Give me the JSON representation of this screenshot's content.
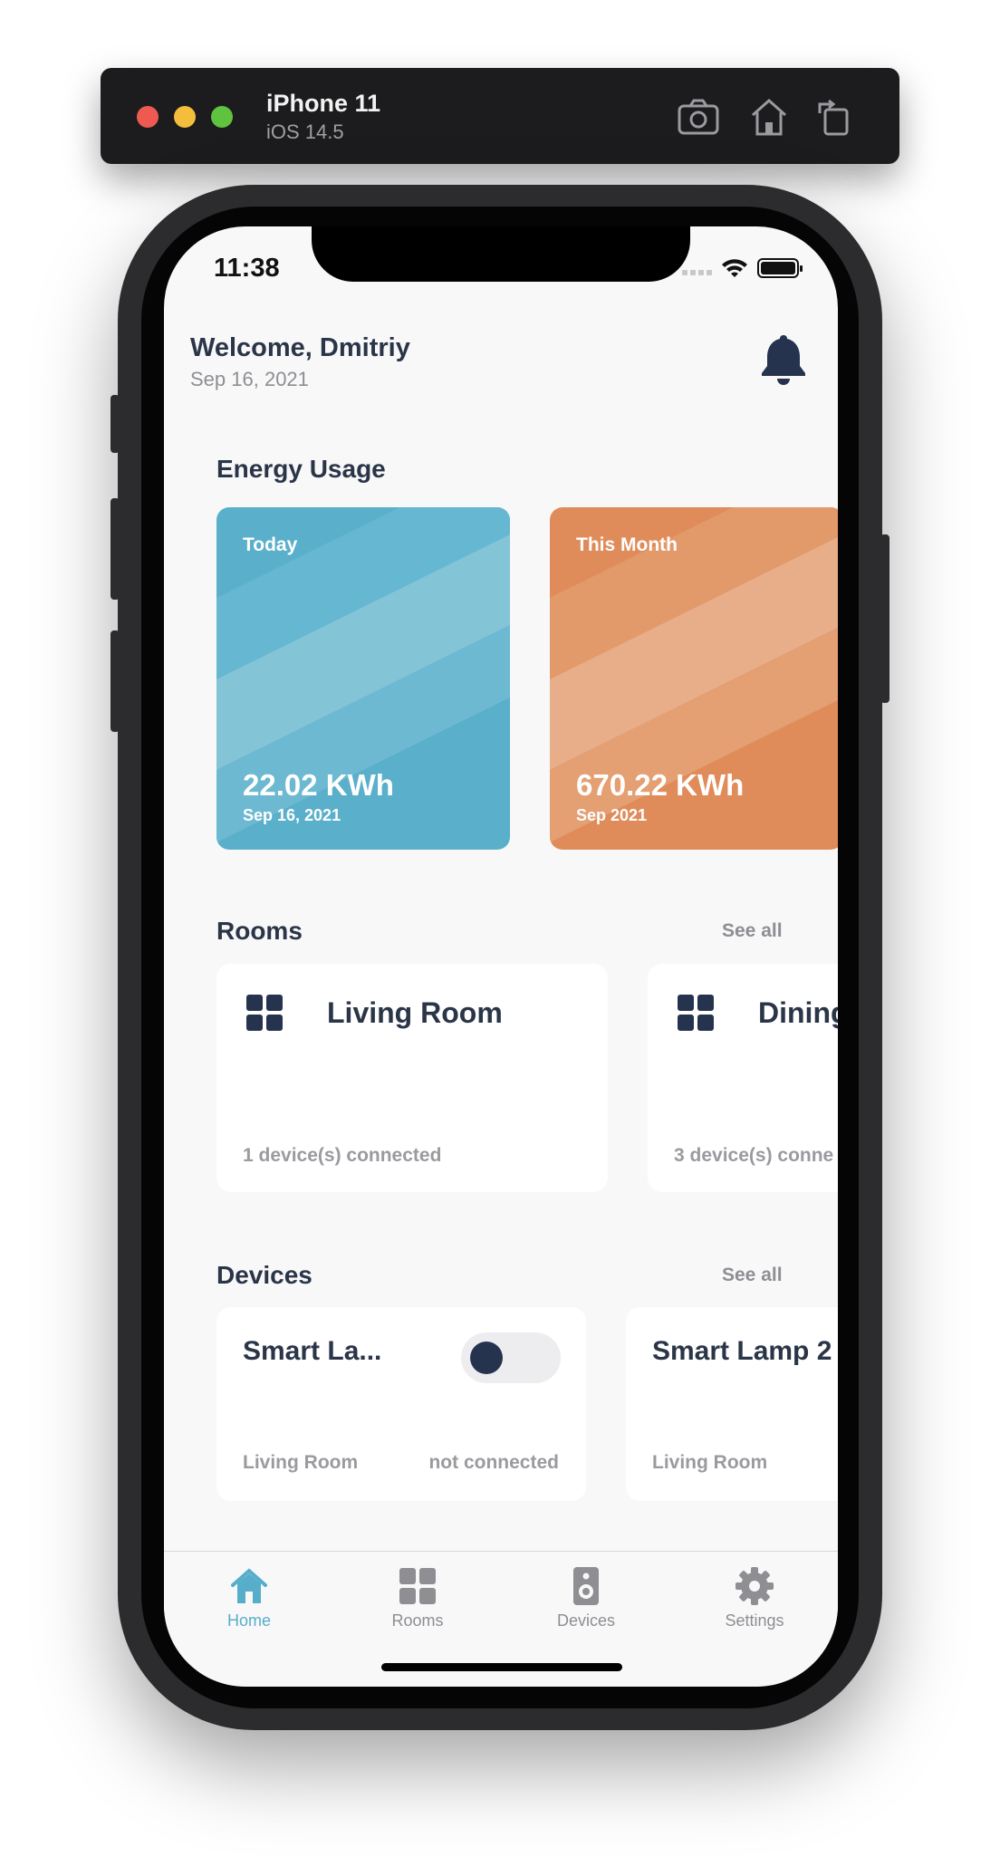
{
  "simulator": {
    "device_name": "iPhone 11",
    "os_version": "iOS 14.5",
    "toolbar_icons": [
      "screenshot-icon",
      "home-icon",
      "rotate-icon"
    ]
  },
  "status_bar": {
    "time": "11:38",
    "icons": [
      "signal-icon",
      "wifi-icon",
      "battery-icon"
    ]
  },
  "header": {
    "welcome": "Welcome, Dmitriy",
    "date": "Sep 16, 2021",
    "notification_icon": "bell-icon"
  },
  "energy": {
    "title": "Energy Usage",
    "cards": [
      {
        "label": "Today",
        "value": "22.02 KWh",
        "date": "Sep 16, 2021",
        "color": "#5aafcb"
      },
      {
        "label": "This Month",
        "value": "670.22 KWh",
        "date": "Sep 2021",
        "color": "#e08c5a"
      }
    ]
  },
  "rooms": {
    "title": "Rooms",
    "see_all": "See all",
    "cards": [
      {
        "name": "Living Room",
        "devices": "1 device(s) connected",
        "icon": "grid-icon"
      },
      {
        "name": "Dining",
        "devices": "3 device(s) conne",
        "icon": "grid-icon"
      }
    ]
  },
  "devices": {
    "title": "Devices",
    "see_all": "See all",
    "cards": [
      {
        "name": "Smart La...",
        "room": "Living Room",
        "status": "not connected",
        "toggle_on": false
      },
      {
        "name": "Smart Lamp 2",
        "room": "Living Room"
      }
    ]
  },
  "tabbar": {
    "active_color": "#56aecb",
    "tabs": [
      {
        "label": "Home",
        "icon": "home-icon",
        "active": true
      },
      {
        "label": "Rooms",
        "icon": "grid-icon",
        "active": false
      },
      {
        "label": "Devices",
        "icon": "speaker-icon",
        "active": false
      },
      {
        "label": "Settings",
        "icon": "gear-icon",
        "active": false
      }
    ]
  }
}
